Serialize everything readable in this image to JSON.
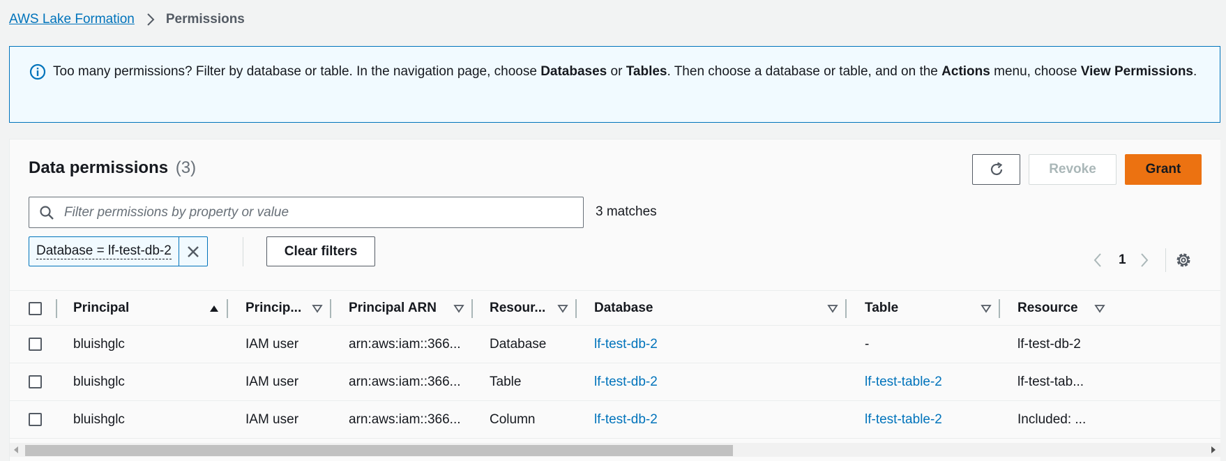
{
  "breadcrumb": {
    "root": "AWS Lake Formation",
    "current": "Permissions"
  },
  "alert": {
    "t1": "Too many permissions? Filter by database or table. In the navigation page, choose ",
    "b1": "Databases",
    "t2": " or ",
    "b2": "Tables",
    "t3": ". Then choose a database or table, and on the ",
    "b3": "Actions",
    "t4": " menu, choose ",
    "b4": "View Permissions",
    "t5": "."
  },
  "panel": {
    "title": "Data permissions",
    "count": "(3)",
    "revoke_label": "Revoke",
    "grant_label": "Grant",
    "search_placeholder": "Filter permissions by property or value",
    "matches": "3 matches",
    "filter_token": "Database = lf-test-db-2",
    "clear_filters": "Clear filters",
    "page": "1"
  },
  "columns": [
    "Principal",
    "Princip...",
    "Principal ARN",
    "Resour...",
    "Database",
    "Table",
    "Resource"
  ],
  "rows": [
    {
      "principal": "bluishglc",
      "type": "IAM user",
      "arn": "arn:aws:iam::366...",
      "resource_type": "Database",
      "database": "lf-test-db-2",
      "table": "-",
      "resource": "lf-test-db-2"
    },
    {
      "principal": "bluishglc",
      "type": "IAM user",
      "arn": "arn:aws:iam::366...",
      "resource_type": "Table",
      "database": "lf-test-db-2",
      "table": "lf-test-table-2",
      "resource": "lf-test-tab..."
    },
    {
      "principal": "bluishglc",
      "type": "IAM user",
      "arn": "arn:aws:iam::366...",
      "resource_type": "Column",
      "database": "lf-test-db-2",
      "table": "lf-test-table-2",
      "resource": "Included: ..."
    }
  ],
  "colors": {
    "link": "#0073bb",
    "accent": "#ec7211",
    "alert_bg": "#f1faff"
  }
}
